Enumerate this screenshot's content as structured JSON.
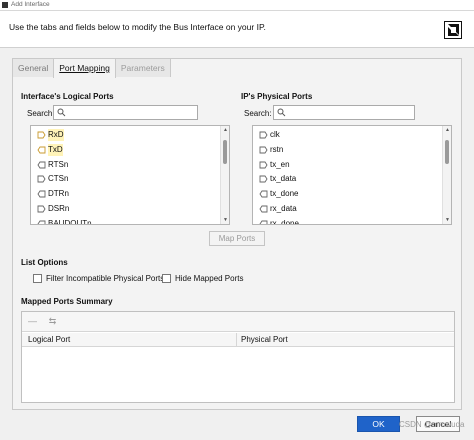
{
  "window": {
    "title": "Add Interface"
  },
  "header": {
    "instruction": "Use the tabs and fields below to modify the Bus Interface on your IP.",
    "logo_icon": "amd-logo-icon"
  },
  "tabs": [
    {
      "label": "General",
      "state": "inactive"
    },
    {
      "label": "Port Mapping",
      "state": "active"
    },
    {
      "label": "Parameters",
      "state": "disabled"
    }
  ],
  "logical_ports": {
    "title": "Interface's Logical Ports",
    "search_label": "Search:",
    "search_placeholder": "Q-",
    "items": [
      {
        "label": "RxD",
        "direction": "in",
        "highlight": true
      },
      {
        "label": "TxD",
        "direction": "out",
        "highlight": true
      },
      {
        "label": "RTSn",
        "direction": "out",
        "highlight": false
      },
      {
        "label": "CTSn",
        "direction": "in",
        "highlight": false
      },
      {
        "label": "DTRn",
        "direction": "out",
        "highlight": false
      },
      {
        "label": "DSRn",
        "direction": "in",
        "highlight": false
      },
      {
        "label": "BAUDOUTn",
        "direction": "out",
        "highlight": false
      }
    ]
  },
  "physical_ports": {
    "title": "IP's Physical Ports",
    "search_label": "Search:",
    "search_placeholder": "Q-",
    "items": [
      {
        "label": "clk",
        "direction": "in"
      },
      {
        "label": "rstn",
        "direction": "in"
      },
      {
        "label": "tx_en",
        "direction": "in"
      },
      {
        "label": "tx_data",
        "direction": "in"
      },
      {
        "label": "tx_done",
        "direction": "out"
      },
      {
        "label": "rx_data",
        "direction": "out"
      },
      {
        "label": "rx_done",
        "direction": "out"
      }
    ]
  },
  "map_ports_button": "Map Ports",
  "list_options": {
    "title": "List Options",
    "filter_label": "Filter Incompatible Physical Ports",
    "hide_label": "Hide Mapped Ports",
    "filter_checked": false,
    "hide_checked": false
  },
  "mapped_summary": {
    "title": "Mapped Ports Summary",
    "toolbar": [
      "remove-icon",
      "auto-map-icon"
    ],
    "columns": [
      "Logical Port",
      "Physical Port"
    ],
    "rows": []
  },
  "footer": {
    "ok": "OK",
    "cancel": "Cancel"
  },
  "watermark": "CSDN @mmwuda",
  "colors": {
    "primary_button": "#1f63c9",
    "highlight": "#fff3b8"
  }
}
